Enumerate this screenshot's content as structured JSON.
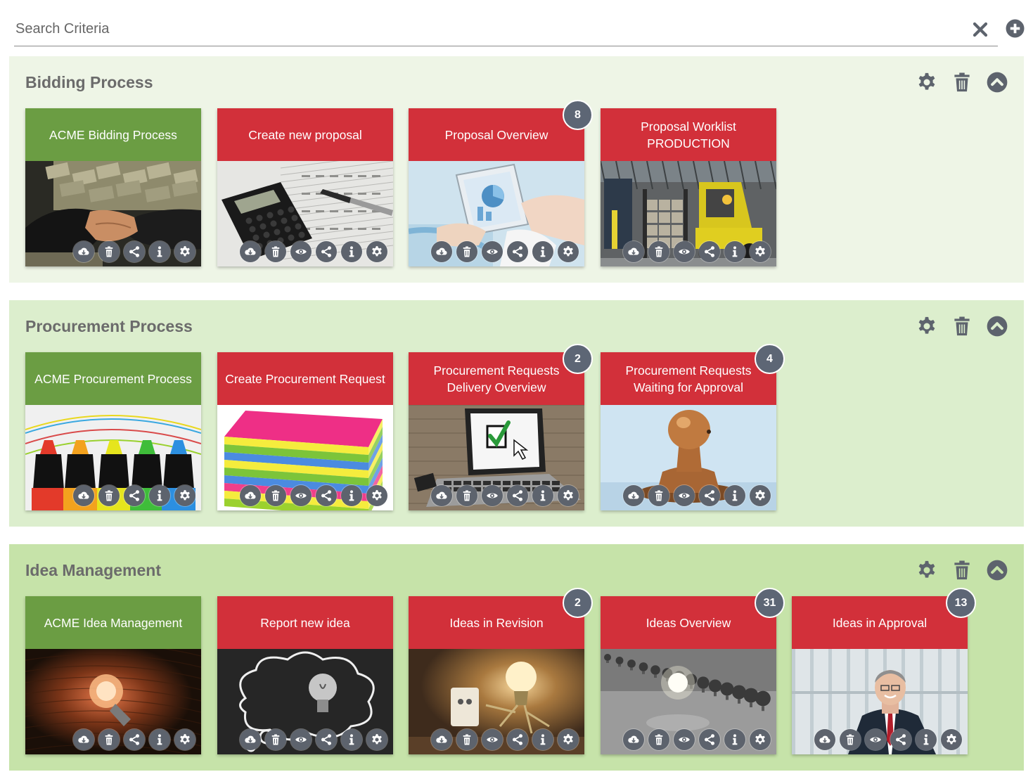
{
  "search": {
    "placeholder": "Search Criteria",
    "value": ""
  },
  "colors": {
    "green_header": "#6b9d43",
    "red_header": "#d2303a",
    "group1_bg": "#eef5e6",
    "group2_bg": "#dceecd",
    "group3_bg": "#c6e3a9",
    "icon_grey": "#5d636d",
    "badge": "#5d6675"
  },
  "groups": [
    {
      "title": "Bidding Process",
      "tiles": [
        {
          "title": "ACME Bidding Process",
          "badge": "",
          "image": "handshake-money"
        },
        {
          "title": "Create new proposal",
          "badge": "",
          "image": "calculator-pen"
        },
        {
          "title": "Proposal Overview",
          "badge": "8",
          "image": "tablet-chart"
        },
        {
          "title": "Proposal Worklist\nPRODUCTION",
          "badge": "",
          "image": "forklift-warehouse"
        }
      ]
    },
    {
      "title": "Procurement Process",
      "tiles": [
        {
          "title": "ACME Procurement Process",
          "badge": "",
          "image": "highlighter-markers"
        },
        {
          "title": "Create Procurement Request",
          "badge": "",
          "image": "sticky-note-stack"
        },
        {
          "title": "Procurement Requests\nDelivery Overview",
          "badge": "2",
          "image": "laptop-checkbox"
        },
        {
          "title": "Procurement Requests\nWaiting for Approval",
          "badge": "4",
          "image": "rubber-stamp"
        }
      ]
    },
    {
      "title": "Idea Management",
      "tiles": [
        {
          "title": "ACME Idea Management",
          "badge": "",
          "image": "glowing-bulb-wood"
        },
        {
          "title": "Report new idea",
          "badge": "",
          "image": "bulb-chalk-cloud"
        },
        {
          "title": "Ideas in Revision",
          "badge": "2",
          "image": "bulb-figure-socket"
        },
        {
          "title": "Ideas Overview",
          "badge": "31",
          "image": "bulbs-row-one-lit"
        },
        {
          "title": "Ideas in Approval",
          "badge": "13",
          "image": "businessman-smiling"
        }
      ]
    }
  ]
}
